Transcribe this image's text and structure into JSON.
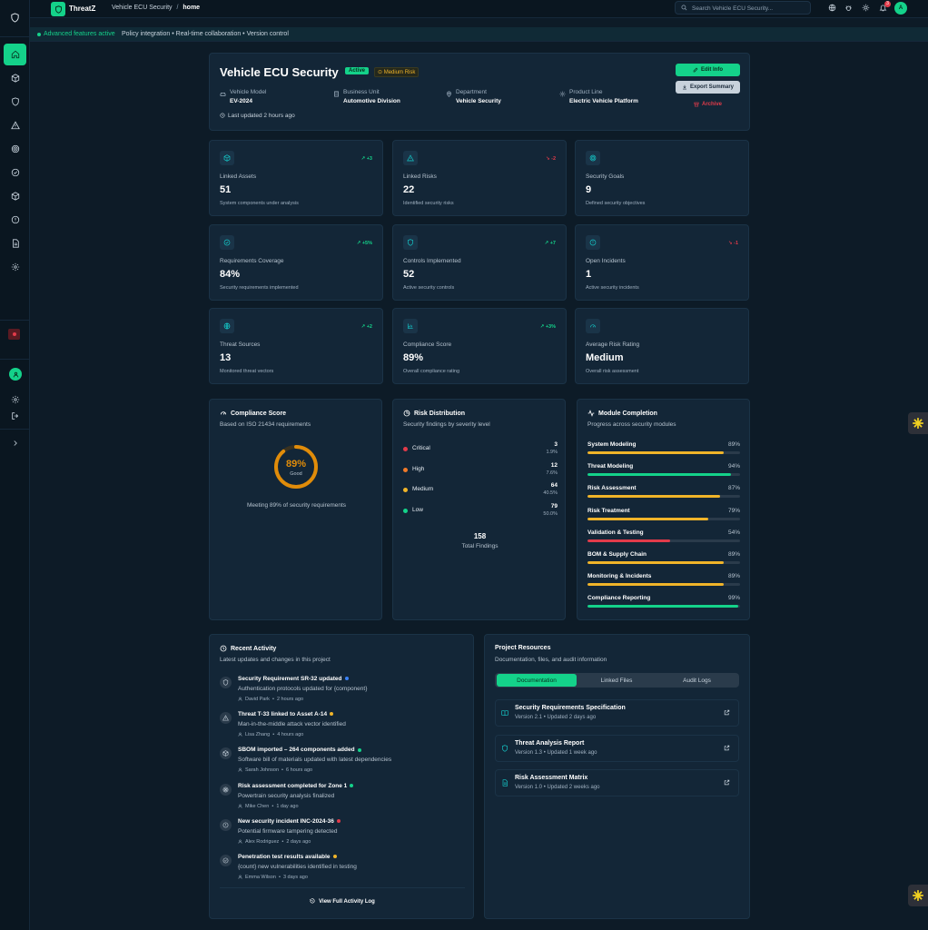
{
  "topbar": {
    "brand": "ThreatZ",
    "crumb_parent": "Vehicle ECU Security",
    "crumb_sep": "/",
    "crumb_current": "home",
    "search_placeholder": "Search Vehicle ECU Security...",
    "notif_count": "3",
    "avatar": "A"
  },
  "banner": {
    "status": "Advanced features active",
    "features": "Policy integration • Real-time collaboration • Version control"
  },
  "project": {
    "title": "Vehicle ECU Security",
    "status": "Active",
    "risk": "Medium Risk",
    "meta": [
      {
        "label": "Vehicle Model",
        "value": "EV-2024",
        "icon": "car-icon"
      },
      {
        "label": "Business Unit",
        "value": "Automotive Division",
        "icon": "building-icon"
      },
      {
        "label": "Department",
        "value": "Vehicle Security",
        "icon": "location-icon"
      },
      {
        "label": "Product Line",
        "value": "Electric Vehicle Platform",
        "icon": "gear-icon"
      }
    ],
    "updated": "Last updated 2 hours ago",
    "edit_label": "Edit Info",
    "export_label": "Export Summary",
    "archive_label": "Archive"
  },
  "stats": [
    {
      "label": "Linked Assets",
      "value": "51",
      "sub": "System components under analysis",
      "delta": "+3",
      "dir": "up",
      "icon": "cube-icon"
    },
    {
      "label": "Linked Risks",
      "value": "22",
      "sub": "Identified security risks",
      "delta": "-2",
      "dir": "down",
      "icon": "warning-icon"
    },
    {
      "label": "Security Goals",
      "value": "9",
      "sub": "Defined security objectives",
      "delta": "",
      "dir": "up",
      "icon": "target-icon"
    },
    {
      "label": "Requirements Coverage",
      "value": "84%",
      "sub": "Security requirements implemented",
      "delta": "+5%",
      "dir": "up",
      "icon": "check-circle-icon"
    },
    {
      "label": "Controls Implemented",
      "value": "52",
      "sub": "Active security controls",
      "delta": "+7",
      "dir": "up",
      "icon": "shield-icon"
    },
    {
      "label": "Open Incidents",
      "value": "1",
      "sub": "Active security incidents",
      "delta": "-1",
      "dir": "down",
      "icon": "alert-circle-icon"
    },
    {
      "label": "Threat Sources",
      "value": "13",
      "sub": "Monitored threat vectors",
      "delta": "+2",
      "dir": "up",
      "icon": "globe-icon"
    },
    {
      "label": "Compliance Score",
      "value": "89%",
      "sub": "Overall compliance rating",
      "delta": "+3%",
      "dir": "up",
      "icon": "bar-chart-icon"
    },
    {
      "label": "Average Risk Rating",
      "value": "Medium",
      "sub": "Overall risk assessment",
      "delta": "",
      "dir": "up",
      "icon": "gauge-icon"
    }
  ],
  "compliance": {
    "title": "Compliance Score",
    "subtitle": "Based on ISO 21434 requirements",
    "value": "89%",
    "fraction": 0.89,
    "rating": "Good",
    "caption": "Meeting 89% of security requirements"
  },
  "risk_dist": {
    "title": "Risk Distribution",
    "subtitle": "Security findings by severity level",
    "rows": [
      {
        "name": "Critical",
        "count": "3",
        "pct": "1.9%",
        "color": "#e23b4a"
      },
      {
        "name": "High",
        "count": "12",
        "pct": "7.6%",
        "color": "#f07a29"
      },
      {
        "name": "Medium",
        "count": "64",
        "pct": "40.5%",
        "color": "#f0b429"
      },
      {
        "name": "Low",
        "count": "79",
        "pct": "50.0%",
        "color": "#14d28a"
      }
    ],
    "total": "158",
    "total_label": "Total Findings"
  },
  "modules": {
    "title": "Module Completion",
    "subtitle": "Progress across security modules",
    "rows": [
      {
        "name": "System Modeling",
        "pct": "89%",
        "value": 0.89,
        "color": "#f0b429"
      },
      {
        "name": "Threat Modeling",
        "pct": "94%",
        "value": 0.94,
        "color": "#14d28a"
      },
      {
        "name": "Risk Assessment",
        "pct": "87%",
        "value": 0.87,
        "color": "#f0b429"
      },
      {
        "name": "Risk Treatment",
        "pct": "79%",
        "value": 0.79,
        "color": "#f0b429"
      },
      {
        "name": "Validation & Testing",
        "pct": "54%",
        "value": 0.54,
        "color": "#e23b4a"
      },
      {
        "name": "BOM & Supply Chain",
        "pct": "89%",
        "value": 0.89,
        "color": "#f0b429"
      },
      {
        "name": "Monitoring & Incidents",
        "pct": "89%",
        "value": 0.89,
        "color": "#f0b429"
      },
      {
        "name": "Compliance Reporting",
        "pct": "99%",
        "value": 0.99,
        "color": "#14d28a"
      }
    ]
  },
  "activity": {
    "title": "Recent Activity",
    "subtitle": "Latest updates and changes in this project",
    "items": [
      {
        "title": "Security Requirement SR-32 updated",
        "desc": "Authentication protocols updated for {component}",
        "user": "David Park",
        "time": "2 hours ago",
        "dot": "#3b82f6",
        "icon": "shield-icon"
      },
      {
        "title": "Threat T-33 linked to Asset A-14",
        "desc": "Man-in-the-middle attack vector identified",
        "user": "Lisa Zhang",
        "time": "4 hours ago",
        "dot": "#f0b429",
        "icon": "warning-icon"
      },
      {
        "title": "SBOM imported – 264 components added",
        "desc": "Software bill of materials updated with latest dependencies",
        "user": "Sarah Johnson",
        "time": "6 hours ago",
        "dot": "#14d28a",
        "icon": "cube-icon"
      },
      {
        "title": "Risk assessment completed for Zone 1",
        "desc": "Powertrain security analysis finalized",
        "user": "Mike Chen",
        "time": "1 day ago",
        "dot": "#14d28a",
        "icon": "target-icon"
      },
      {
        "title": "New security incident INC-2024-36",
        "desc": "Potential firmware tampering detected",
        "user": "Alex Rodriguez",
        "time": "2 days ago",
        "dot": "#e23b4a",
        "icon": "alert-circle-icon"
      },
      {
        "title": "Penetration test results available",
        "desc": "{count} new vulnerabilities identified in testing",
        "user": "Emma Wilson",
        "time": "3 days ago",
        "dot": "#f0b429",
        "icon": "check-circle-icon"
      }
    ],
    "link": "View Full Activity Log"
  },
  "resources": {
    "title": "Project Resources",
    "subtitle": "Documentation, files, and audit information",
    "tabs": [
      "Documentation",
      "Linked Files",
      "Audit Logs"
    ],
    "docs": [
      {
        "title": "Security Requirements Specification",
        "sub": "Version 2.1 • Updated 2 days ago",
        "icon": "book-icon"
      },
      {
        "title": "Threat Analysis Report",
        "sub": "Version 1.3 • Updated 1 week ago",
        "icon": "shield-icon"
      },
      {
        "title": "Risk Assessment Matrix",
        "sub": "Version 1.0 • Updated 2 weeks ago",
        "icon": "document-icon"
      }
    ]
  }
}
